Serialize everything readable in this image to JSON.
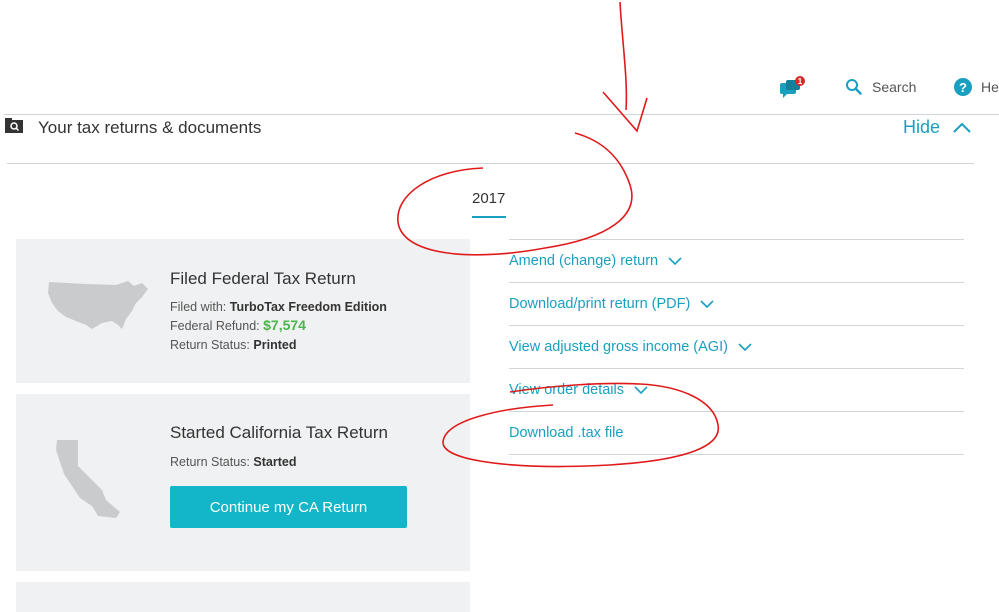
{
  "nav": {
    "chat_badge": "1",
    "search_label": "Search",
    "help_label": "He"
  },
  "section": {
    "title": "Your tax returns & documents",
    "hide_label": "Hide"
  },
  "year_tab": "2017",
  "federal": {
    "title": "Filed Federal Tax Return",
    "filed_with_label": "Filed with:",
    "filed_with_value": "TurboTax Freedom Edition",
    "refund_label": "Federal Refund:",
    "refund_value": "$7,574",
    "status_label": "Return Status:",
    "status_value": "Printed"
  },
  "state": {
    "title": "Started California Tax Return",
    "status_label": "Return Status:",
    "status_value": "Started",
    "button_label": "Continue my CA Return"
  },
  "actions": [
    {
      "label": "Amend (change) return",
      "has_chevron": true
    },
    {
      "label": "Download/print return (PDF)",
      "has_chevron": true
    },
    {
      "label": "View adjusted gross income (AGI)",
      "has_chevron": true
    },
    {
      "label": "View order details",
      "has_chevron": true
    },
    {
      "label": "Download .tax file",
      "has_chevron": false
    }
  ],
  "colors": {
    "accent": "#1a9fc0",
    "button": "#13b5c8",
    "refund": "#4bb54b",
    "annotation": "#e01a1a",
    "card_bg": "#f0f1f2"
  },
  "icons": [
    "chat-icon",
    "search-icon",
    "help-icon",
    "folder-icon",
    "chevron-up-icon",
    "chevron-down-icon",
    "usa-map-icon",
    "california-map-icon"
  ]
}
